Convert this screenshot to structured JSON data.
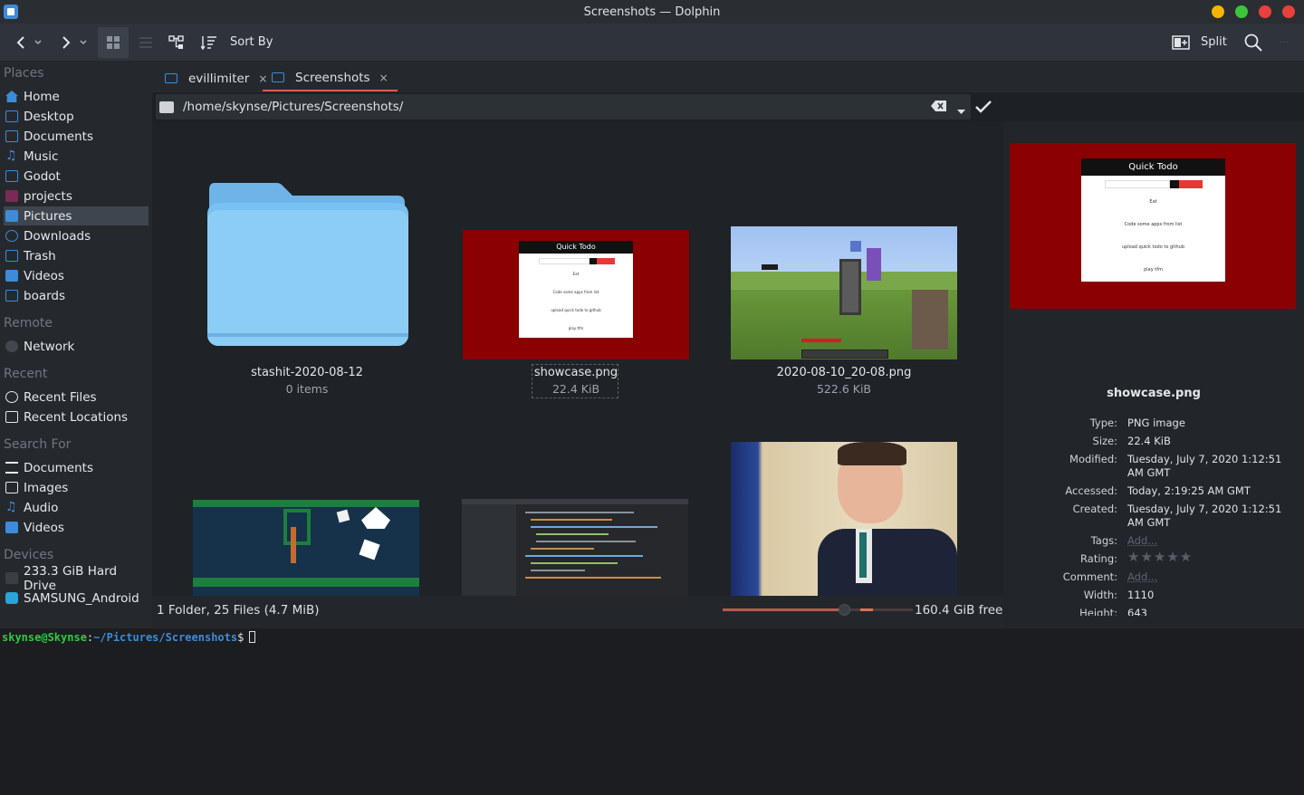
{
  "window": {
    "title": "Screenshots — Dolphin"
  },
  "toolbar": {
    "sort_label": "Sort By",
    "split_label": "Split"
  },
  "sidebar": {
    "places_header": "Places",
    "places": [
      "Home",
      "Desktop",
      "Documents",
      "Music",
      "Godot",
      "projects",
      "Pictures",
      "Downloads",
      "Trash",
      "Videos",
      "boards"
    ],
    "remote_header": "Remote",
    "remote": [
      "Network"
    ],
    "recent_header": "Recent",
    "recent": [
      "Recent Files",
      "Recent Locations"
    ],
    "search_header": "Search For",
    "search": [
      "Documents",
      "Images",
      "Audio",
      "Videos"
    ],
    "devices_header": "Devices",
    "devices": [
      "233.3 GiB Hard Drive",
      "SAMSUNG_Android"
    ]
  },
  "tabs": [
    "evillimiter",
    "Screenshots"
  ],
  "location": {
    "path": "/home/skynse/Pictures/Screenshots/"
  },
  "files": [
    {
      "name": "stashit-2020-08-12",
      "detail": "0 items"
    },
    {
      "name": "showcase.png",
      "detail": "22.4 KiB"
    },
    {
      "name": "2020-08-10_20-08.png",
      "detail": "522.6 KiB"
    }
  ],
  "thumb_text": {
    "todo_title": "Quick Todo",
    "todo_items": [
      "Eat",
      "Code some apps from list",
      "upload quick todo to github",
      "play tfm"
    ]
  },
  "status": {
    "summary": "1 Folder, 25 Files (4.7 MiB)",
    "free": "160.4 GiB free"
  },
  "info": {
    "filename": "showcase.png",
    "rows": [
      {
        "key": "Type:",
        "value": "PNG image"
      },
      {
        "key": "Size:",
        "value": "22.4 KiB"
      },
      {
        "key": "Modified:",
        "value": "Tuesday, July 7, 2020 1:12:51 AM GMT"
      },
      {
        "key": "Accessed:",
        "value": "Today, 2:19:25 AM GMT"
      },
      {
        "key": "Created:",
        "value": "Tuesday, July 7, 2020 1:12:51 AM GMT"
      },
      {
        "key": "Tags:",
        "value": "Add..."
      },
      {
        "key": "Rating:",
        "value": ""
      },
      {
        "key": "Comment:",
        "value": "Add..."
      },
      {
        "key": "Width:",
        "value": "1110"
      },
      {
        "key": "Height:",
        "value": "643"
      }
    ],
    "rating": 0
  },
  "terminal": {
    "user": "skynse@Skynse",
    "path": "~/Pictures/Screenshots",
    "prompt": "$"
  },
  "colors": {
    "accent": "#3d8bd9",
    "tab_underline": "#e95a4b",
    "terminal_green": "#2ecc40",
    "terminal_blue": "#3d8bd9"
  }
}
